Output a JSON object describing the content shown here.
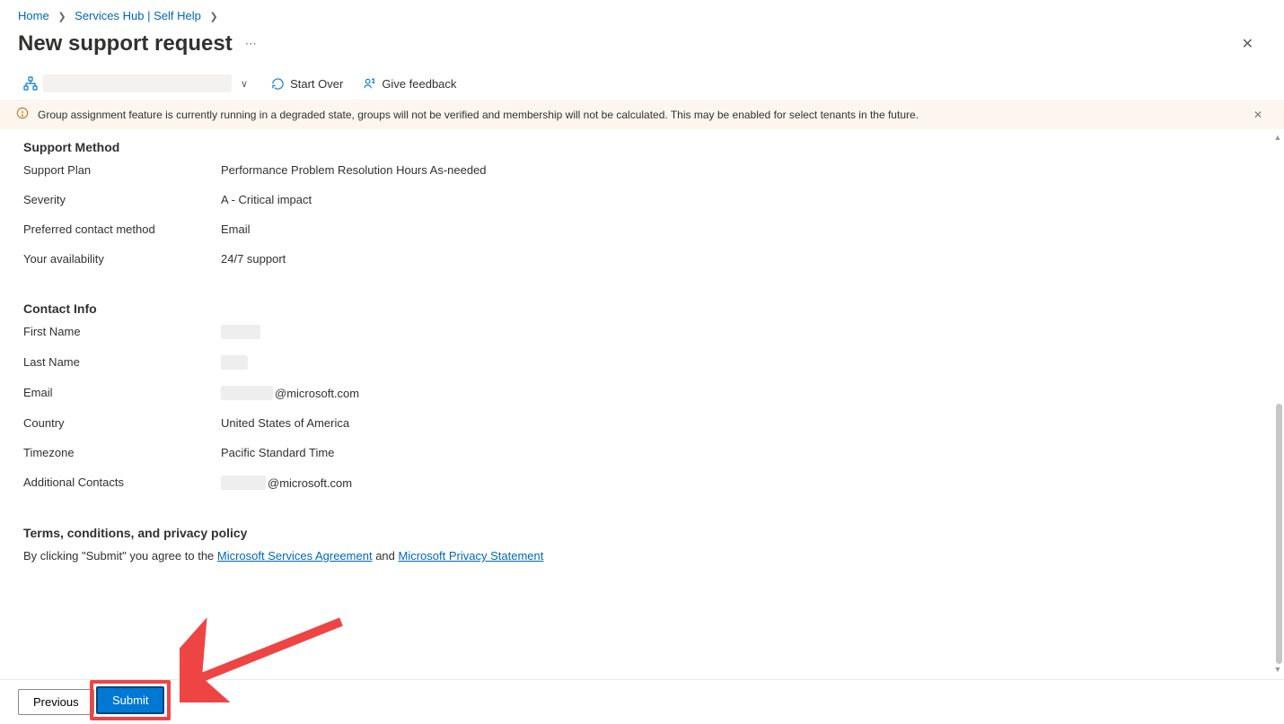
{
  "breadcrumb": {
    "home": "Home",
    "hub": "Services Hub | Self Help"
  },
  "page": {
    "title": "New support request"
  },
  "toolbar": {
    "start_over": "Start Over",
    "give_feedback": "Give feedback"
  },
  "banner": {
    "text": "Group assignment feature is currently running in a degraded state, groups will not be verified and membership will not be calculated. This may be enabled for select tenants in the future."
  },
  "support_method": {
    "heading": "Support Method",
    "rows": {
      "support_plan": {
        "label": "Support Plan",
        "value": "Performance Problem Resolution Hours As-needed"
      },
      "severity": {
        "label": "Severity",
        "value": "A - Critical impact"
      },
      "preferred_contact": {
        "label": "Preferred contact method",
        "value": "Email"
      },
      "availability": {
        "label": "Your availability",
        "value": "24/7 support"
      }
    }
  },
  "contact": {
    "heading": "Contact Info",
    "rows": {
      "first_name": {
        "label": "First Name"
      },
      "last_name": {
        "label": "Last Name"
      },
      "email": {
        "label": "Email",
        "suffix": "@microsoft.com"
      },
      "country": {
        "label": "Country",
        "value": "United States of America"
      },
      "timezone": {
        "label": "Timezone",
        "value": "Pacific Standard Time"
      },
      "additional": {
        "label": "Additional Contacts",
        "suffix": "@microsoft.com"
      }
    }
  },
  "terms": {
    "heading": "Terms, conditions, and privacy policy",
    "prefix": "By clicking \"Submit\" you agree to the ",
    "link1": "Microsoft Services Agreement",
    "mid": " and ",
    "link2": "Microsoft Privacy Statement"
  },
  "footer": {
    "previous": "Previous",
    "submit": "Submit"
  }
}
